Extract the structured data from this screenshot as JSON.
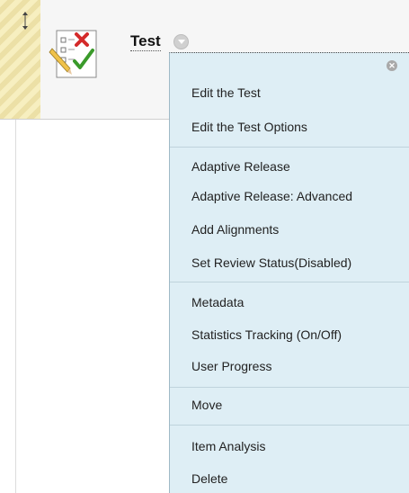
{
  "item": {
    "title": "Test",
    "icon": "test-checklist-icon"
  },
  "menu": {
    "close_icon": "close-circle-icon",
    "close_glyph": "✕",
    "items": [
      "Edit the Test",
      "Edit the Test Options",
      "Adaptive Release",
      "Adaptive Release: Advanced",
      "Add Alignments",
      "Set Review Status(Disabled)",
      "Metadata",
      "Statistics Tracking (On/Off)",
      "User Progress",
      "Move",
      "Item Analysis",
      "Delete"
    ]
  },
  "colors": {
    "menu_background": "#deeef5",
    "drag_strip": "#f7efc0",
    "row_background": "#f6f6f6"
  }
}
